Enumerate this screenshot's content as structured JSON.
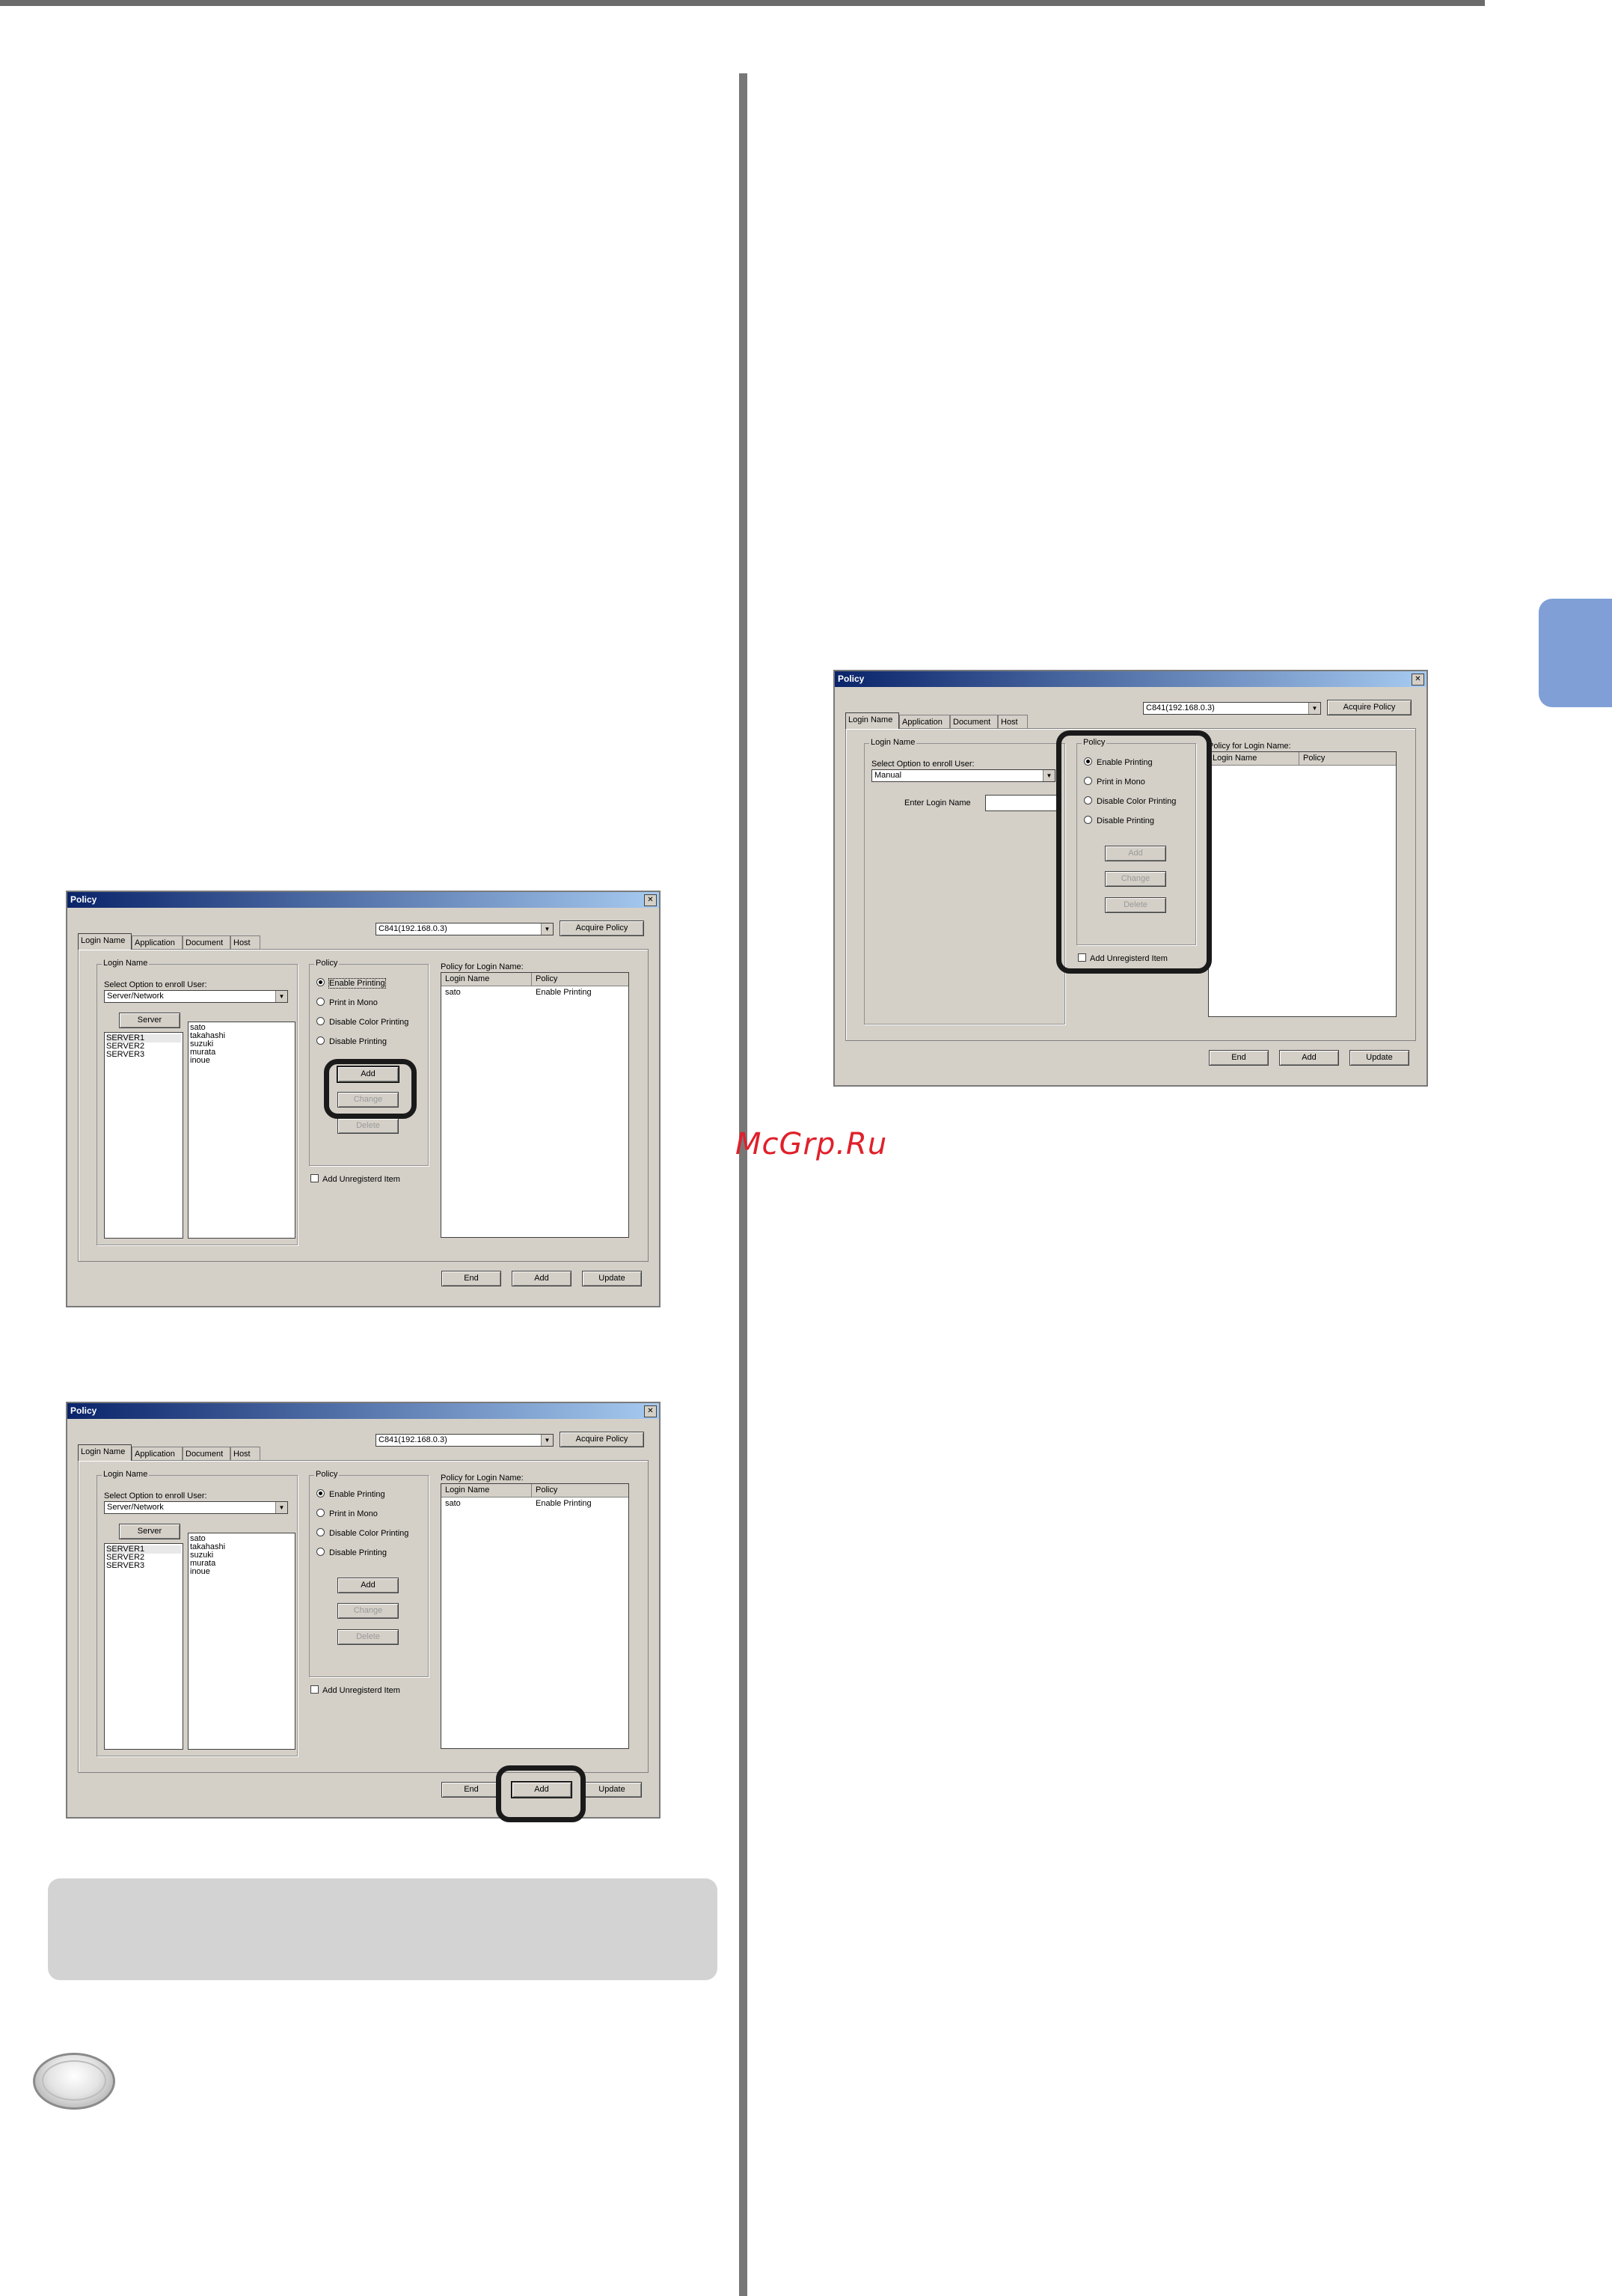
{
  "watermark": "McGrp.Ru",
  "dialog1": {
    "title": "Policy",
    "printer": "C841(192.168.0.3)",
    "acquire_label": "Acquire Policy",
    "tabs": [
      "Login Name",
      "Application",
      "Document",
      "Host"
    ],
    "login_group": "Login Name",
    "select_label": "Select Option to enroll User:",
    "option_value": "Server/Network",
    "server_label": "Server",
    "servers": [
      "SERVER1",
      "SERVER2",
      "SERVER3"
    ],
    "users": [
      "sato",
      "takahashi",
      "suzuki",
      "murata",
      "inoue"
    ],
    "policy_group": "Policy",
    "policy_options": [
      "Enable Printing",
      "Print in Mono",
      "Disable Color Printing",
      "Disable Printing"
    ],
    "add_label": "Add",
    "change_label": "Change",
    "delete_label": "Delete",
    "unregistered_label": "Add Unregisterd Item",
    "policy_for_label": "Policy for Login Name:",
    "col_login": "Login Name",
    "col_policy": "Policy",
    "row_login": "sato",
    "row_policy": "Enable Printing",
    "end_label": "End",
    "bottom_add_label": "Add",
    "update_label": "Update"
  },
  "dialog2": {
    "title": "Policy",
    "printer": "C841(192.168.0.3)",
    "acquire_label": "Acquire Policy",
    "tabs": [
      "Login Name",
      "Application",
      "Document",
      "Host"
    ],
    "login_group": "Login Name",
    "select_label": "Select Option to enroll User:",
    "option_value": "Server/Network",
    "server_label": "Server",
    "servers": [
      "SERVER1",
      "SERVER2",
      "SERVER3"
    ],
    "users": [
      "sato",
      "takahashi",
      "suzuki",
      "murata",
      "inoue"
    ],
    "policy_group": "Policy",
    "policy_options": [
      "Enable Printing",
      "Print in Mono",
      "Disable Color Printing",
      "Disable Printing"
    ],
    "add_label": "Add",
    "change_label": "Change",
    "delete_label": "Delete",
    "unregistered_label": "Add Unregisterd Item",
    "policy_for_label": "Policy for Login Name:",
    "col_login": "Login Name",
    "col_policy": "Policy",
    "row_login": "sato",
    "row_policy": "Enable Printing",
    "end_label": "End",
    "bottom_add_label": "Add",
    "update_label": "Update"
  },
  "dialog3": {
    "title": "Policy",
    "printer": "C841(192.168.0.3)",
    "acquire_label": "Acquire Policy",
    "tabs": [
      "Login Name",
      "Application",
      "Document",
      "Host"
    ],
    "login_group": "Login Name",
    "select_label": "Select Option to enroll User:",
    "option_value": "Manual",
    "enter_label": "Enter Login Name",
    "policy_group": "Policy",
    "policy_options": [
      "Enable Printing",
      "Print in Mono",
      "Disable Color Printing",
      "Disable Printing"
    ],
    "add_label": "Add",
    "change_label": "Change",
    "delete_label": "Delete",
    "unregistered_label": "Add Unregisterd Item",
    "policy_for_label": "Policy for Login Name:",
    "col_login": "Login Name",
    "col_policy": "Policy",
    "end_label": "End",
    "bottom_add_label": "Add",
    "update_label": "Update"
  }
}
